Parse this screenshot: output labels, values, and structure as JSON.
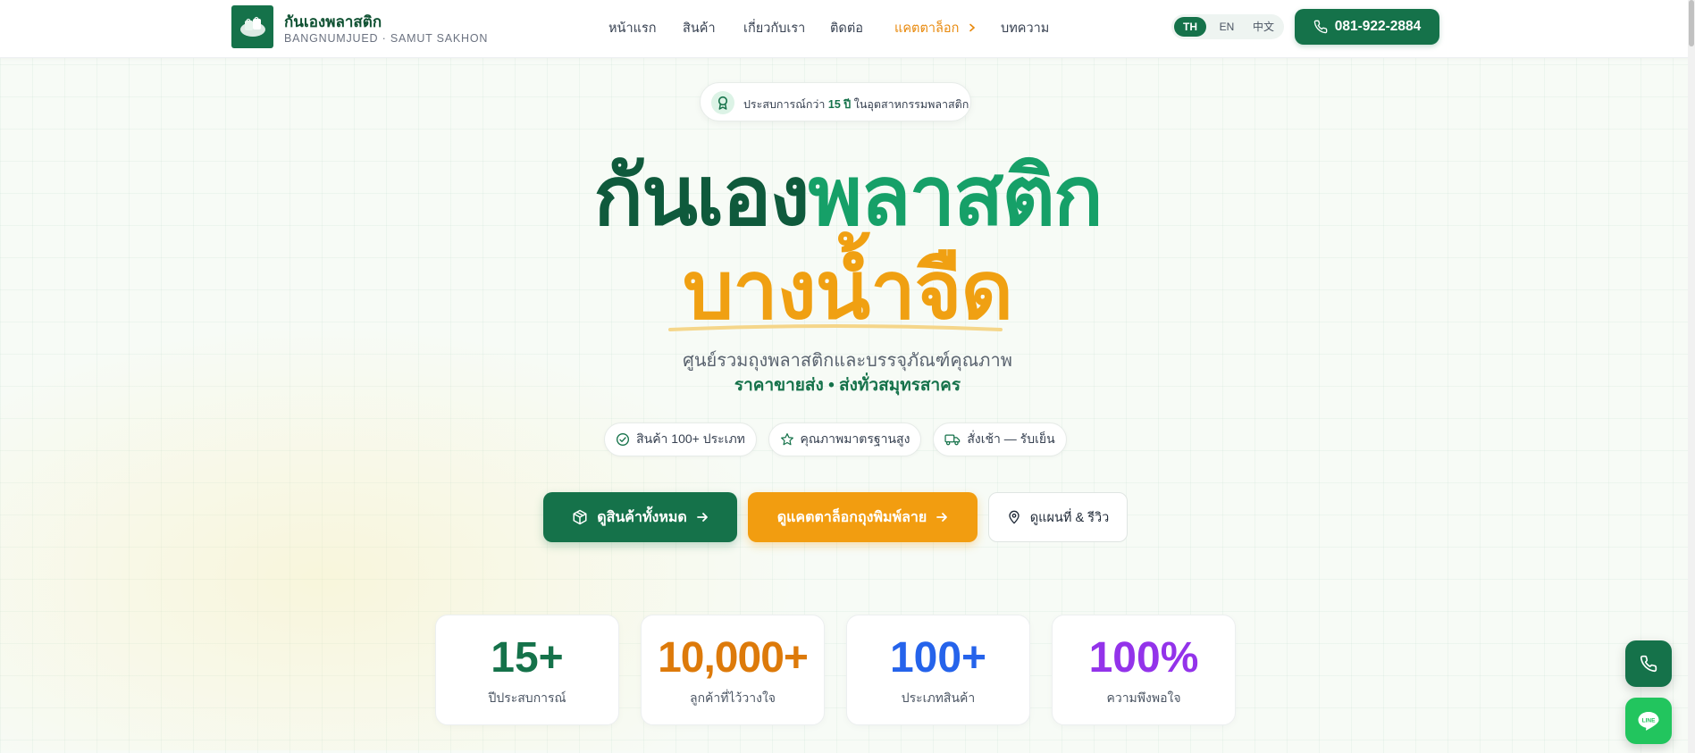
{
  "header": {
    "brand_name": "กันเองพลาสติก",
    "brand_sub": "BANGNUMJUED · SAMUT SAKHON",
    "nav": [
      {
        "label": "หน้าแรก"
      },
      {
        "label": "สินค้า"
      },
      {
        "label": "เกี่ยวกับเรา"
      },
      {
        "label": "ติดต่อ"
      },
      {
        "label": "แคตตาล็อก"
      },
      {
        "label": "บทความ"
      }
    ],
    "languages": [
      "TH",
      "EN",
      "中文"
    ],
    "active_language": "TH",
    "phone": "081-922-2884",
    "accent_color": "#15724a"
  },
  "hero": {
    "badge_prefix": "ประสบการณ์กว่า",
    "badge_years": "15 ปี",
    "badge_suffix": "ในอุตสาหกรรมพลาสติก",
    "title_part1": "กันเอง",
    "title_part2": "พลาสติก",
    "title_line2": "บางน้ำจืด",
    "subtitle": "ศูนย์รวมถุงพลาสติกและบรรจุภัณฑ์คุณภาพ",
    "tagline": "ราคาขายส่ง • ส่งทั่วสมุทรสาคร",
    "features": [
      {
        "label": "สินค้า 100+ ประเภท",
        "icon": "check-circle-icon"
      },
      {
        "label": "คุณภาพมาตรฐานสูง",
        "icon": "star-icon"
      },
      {
        "label": "สั่งเช้า — รับเย็น",
        "icon": "truck-icon"
      }
    ],
    "cta_products": "ดูสินค้าทั้งหมด",
    "cta_catalog": "ดูแคตตาล็อกถุงพิมพ์ลาย",
    "cta_map": "ดูแผนที่ & รีวิว",
    "orange_color": "#f29d10"
  },
  "stats": [
    {
      "value": "15+",
      "label": "ปีประสบการณ์",
      "color": "#15724a"
    },
    {
      "value": "10,000+",
      "label": "ลูกค้าที่ไว้วางใจ",
      "color": "#dd7a0a"
    },
    {
      "value": "100+",
      "label": "ประเภทสินค้า",
      "color": "#2563eb"
    },
    {
      "value": "100%",
      "label": "ความพึงพอใจ",
      "color": "#9333ea"
    }
  ],
  "floating": {
    "phone_icon": "phone-icon",
    "line_icon": "line-chat-icon",
    "line_label": "LINE"
  }
}
